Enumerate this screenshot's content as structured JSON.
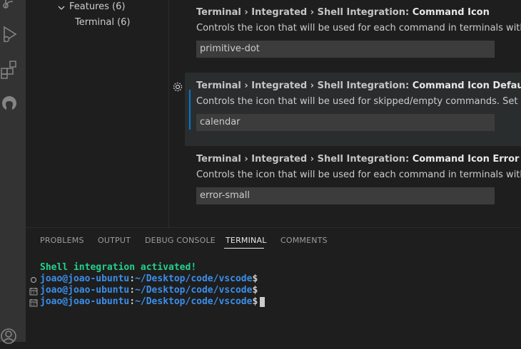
{
  "tree": {
    "features_label": "Features (6)",
    "terminal_label": "Terminal (6)"
  },
  "settings": [
    {
      "category": "Terminal › Integrated › Shell Integration: ",
      "name": "Command Icon",
      "description": "Controls the icon that will be used for each command in terminals with shell in",
      "value": "primitive-dot"
    },
    {
      "category": "Terminal › Integrated › Shell Integration: ",
      "name": "Command Icon Default",
      "description": "Controls the icon that will be used for skipped/empty commands. Set to '' to h",
      "value": "calendar"
    },
    {
      "category": "Terminal › Integrated › Shell Integration: ",
      "name": "Command Icon Error",
      "description": "Controls the icon that will be used for each command in terminals with shell in",
      "value": "error-small"
    }
  ],
  "panel": {
    "tabs": [
      "PROBLEMS",
      "OUTPUT",
      "DEBUG CONSOLE",
      "TERMINAL",
      "COMMENTS"
    ],
    "active_tab": "TERMINAL"
  },
  "terminal": {
    "banner": "Shell integration activated!",
    "prompt_user": "joao@joao-ubuntu",
    "prompt_sep": ":",
    "prompt_path": "~/Desktop/code/vscode",
    "prompt_symbol": "$"
  },
  "icons": {
    "activity": [
      "source-control-icon",
      "run-debug-icon",
      "extensions-icon",
      "github-icon",
      "account-icon"
    ],
    "line_decorations": [
      "primitive-dot-icon",
      "calendar-icon",
      "calendar-icon"
    ]
  },
  "colors": {
    "focus_border": "#0078d4",
    "terminal_green": "#23d18b",
    "terminal_blue": "#3b8eea"
  }
}
